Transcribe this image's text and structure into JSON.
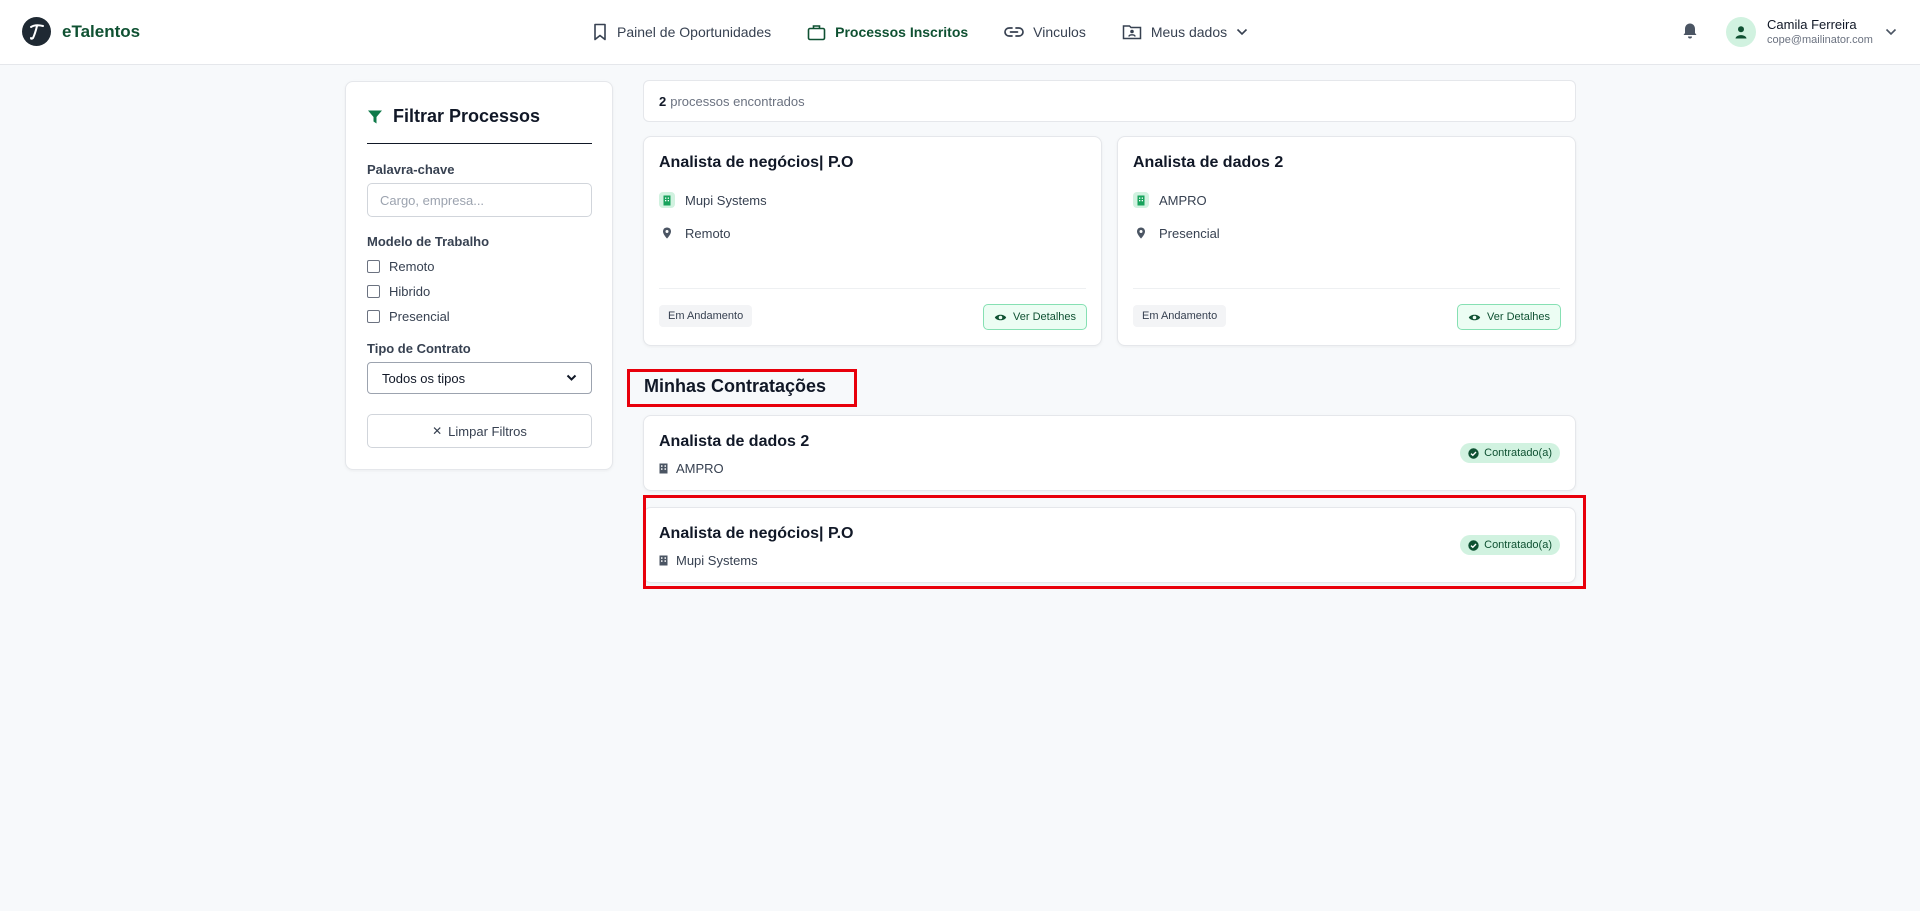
{
  "brand": {
    "name": "eTalentos",
    "logo_letter": "T"
  },
  "nav": [
    {
      "label": "Painel de Oportunidades",
      "icon": "bookmark-icon"
    },
    {
      "label": "Processos Inscritos",
      "icon": "briefcase-icon",
      "active": true
    },
    {
      "label": "Vinculos",
      "icon": "link-icon"
    },
    {
      "label": "Meus dados",
      "icon": "folder-user-icon"
    }
  ],
  "user": {
    "name": "Camila Ferreira",
    "email": "cope@mailinator.com"
  },
  "sidebar": {
    "title": "Filtrar Processos",
    "keyword_label": "Palavra-chave",
    "keyword_placeholder": "Cargo, empresa...",
    "work_model_label": "Modelo de Trabalho",
    "work_models": [
      "Remoto",
      "Hibrido",
      "Presencial"
    ],
    "contract_label": "Tipo de Contrato",
    "contract_selected": "Todos os tipos",
    "clear_label": "Limpar Filtros"
  },
  "results": {
    "count": "2",
    "text": "processos encontrados"
  },
  "processes": [
    {
      "title": "Analista de negócios| P.O",
      "company": "Mupi Systems",
      "location": "Remoto",
      "status": "Em Andamento",
      "action": "Ver Detalhes"
    },
    {
      "title": "Analista de dados 2",
      "company": "AMPRO",
      "location": "Presencial",
      "status": "Em Andamento",
      "action": "Ver Detalhes"
    }
  ],
  "hires": {
    "title": "Minhas Contratações",
    "items": [
      {
        "title": "Analista de dados 2",
        "company": "AMPRO",
        "badge": "Contratado(a)"
      },
      {
        "title": "Analista de negócios| P.O",
        "company": "Mupi Systems",
        "badge": "Contratado(a)"
      }
    ]
  },
  "colors": {
    "brand_green": "#0f5132",
    "accent_light": "#d1f2e0",
    "highlight_red": "#e8000b"
  }
}
